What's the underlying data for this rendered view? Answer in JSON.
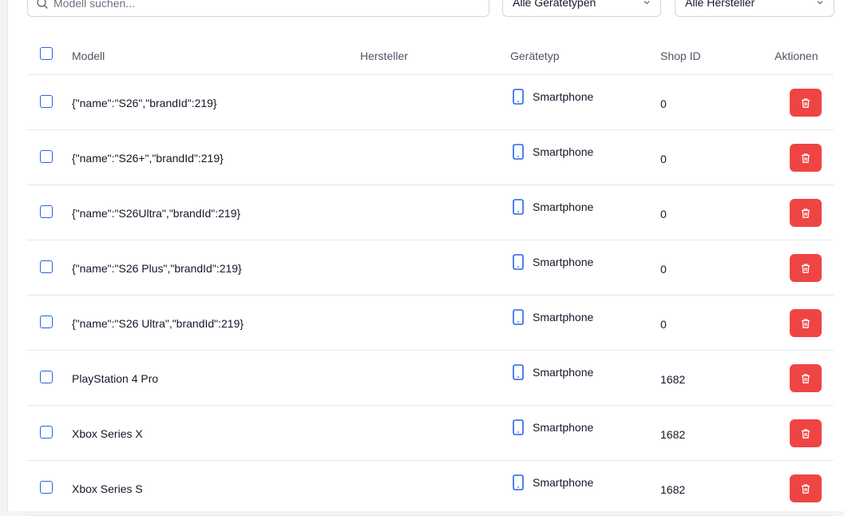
{
  "filters": {
    "search_placeholder": "Modell suchen...",
    "device_type_selected": "Alle Gerätetypen",
    "manufacturer_selected": "Alle Hersteller"
  },
  "table": {
    "headers": {
      "model": "Modell",
      "manufacturer": "Hersteller",
      "device_type": "Gerätetyp",
      "shop_id": "Shop ID",
      "actions": "Aktionen"
    },
    "rows": [
      {
        "model": "{\"name\":\"S26\",\"brandId\":219}",
        "manufacturer": "",
        "device_type": "Smartphone",
        "shop_id": "0"
      },
      {
        "model": "{\"name\":\"S26+\",\"brandId\":219}",
        "manufacturer": "",
        "device_type": "Smartphone",
        "shop_id": "0"
      },
      {
        "model": "{\"name\":\"S26Ultra\",\"brandId\":219}",
        "manufacturer": "",
        "device_type": "Smartphone",
        "shop_id": "0"
      },
      {
        "model": "{\"name\":\"S26 Plus\",\"brandId\":219}",
        "manufacturer": "",
        "device_type": "Smartphone",
        "shop_id": "0"
      },
      {
        "model": "{\"name\":\"S26 Ultra\",\"brandId\":219}",
        "manufacturer": "",
        "device_type": "Smartphone",
        "shop_id": "0"
      },
      {
        "model": "PlayStation 4 Pro",
        "manufacturer": "",
        "device_type": "Smartphone",
        "shop_id": "1682"
      },
      {
        "model": "Xbox Series X",
        "manufacturer": "",
        "device_type": "Smartphone",
        "shop_id": "1682"
      },
      {
        "model": "Xbox Series S",
        "manufacturer": "",
        "device_type": "Smartphone",
        "shop_id": "1682"
      }
    ]
  },
  "colors": {
    "accent": "#2563eb",
    "delete": "#ef4444",
    "border": "#e5e7eb"
  },
  "icons": {
    "search": "search-icon",
    "device": "smartphone-icon",
    "delete": "trash-icon",
    "dropdown": "chevron-down-icon"
  }
}
